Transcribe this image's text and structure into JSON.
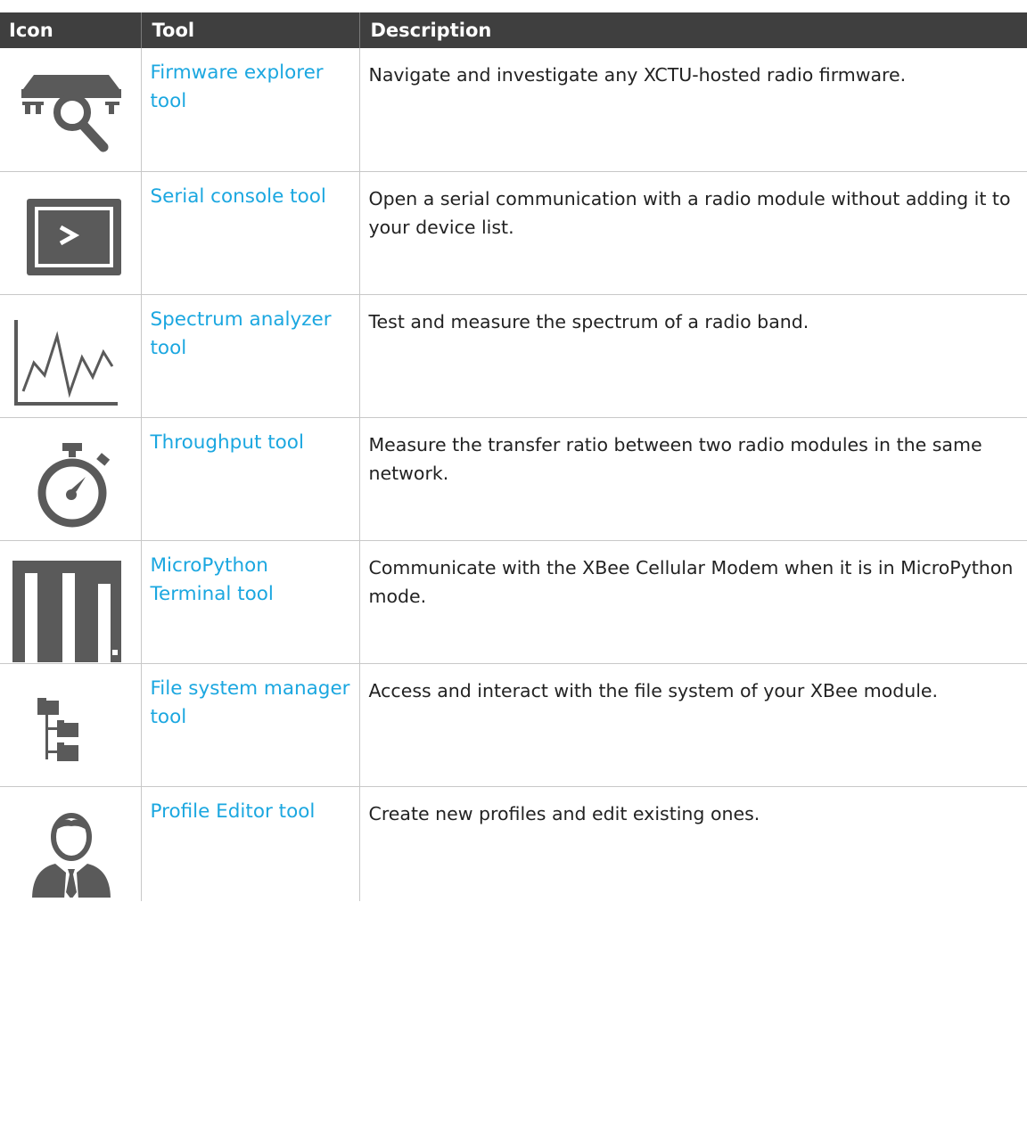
{
  "table": {
    "headers": {
      "icon": "Icon",
      "tool": "Tool",
      "description": "Description"
    },
    "rows": [
      {
        "icon": "firmware-explorer-icon",
        "tool": "Firmware explorer tool",
        "description": "Navigate and investigate any XCTU-hosted radio firmware."
      },
      {
        "icon": "serial-console-icon",
        "tool": "Serial console tool",
        "description": "Open a serial communication with a radio module without adding it to your device list."
      },
      {
        "icon": "spectrum-analyzer-icon",
        "tool": "Spectrum analyzer tool",
        "description": "Test and measure the spectrum of a radio band."
      },
      {
        "icon": "stopwatch-icon",
        "tool": "Throughput tool",
        "description": "Measure the transfer ratio between two radio modules in the same network."
      },
      {
        "icon": "micropython-icon",
        "tool": "MicroPython Terminal tool",
        "description": "Communicate with the XBee Cellular Modem when it is in MicroPython mode."
      },
      {
        "icon": "file-system-tree-icon",
        "tool": "File system manager tool",
        "description": "Access and interact with the file system of your XBee module."
      },
      {
        "icon": "profile-user-icon",
        "tool": "Profile Editor tool",
        "description": "Create new profiles and edit existing ones."
      }
    ]
  },
  "colors": {
    "header_bg": "#3f3f3f",
    "header_text": "#ffffff",
    "link": "#1ba7e0",
    "icon_gray": "#5a5a5a",
    "grid_line": "#c8c8c8"
  }
}
